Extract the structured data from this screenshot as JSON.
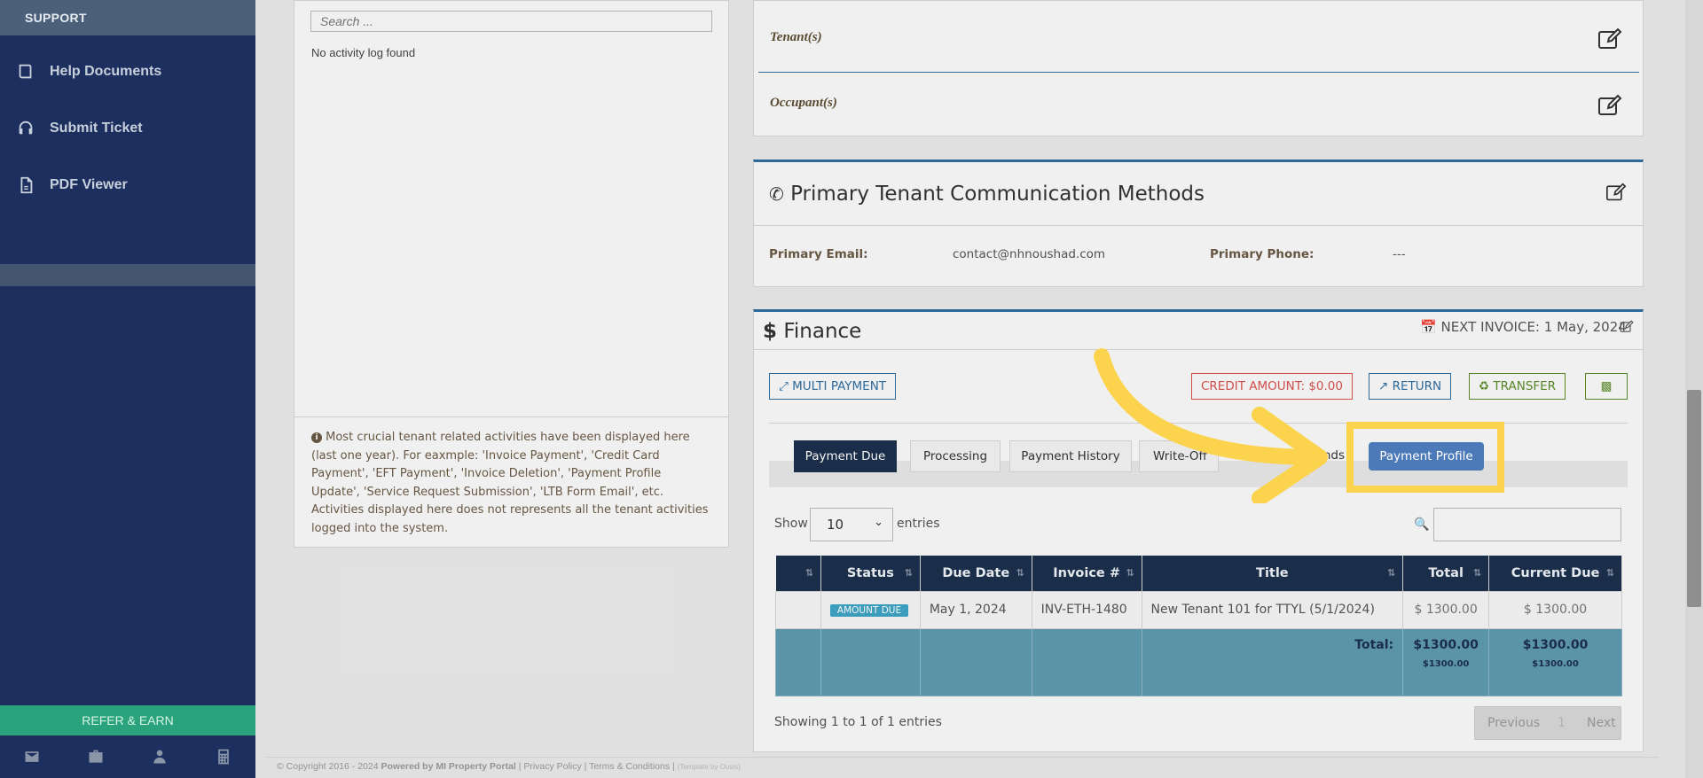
{
  "sidebar": {
    "header": "SUPPORT",
    "items": [
      {
        "label": "Help Documents",
        "icon": "book-icon"
      },
      {
        "label": "Submit Ticket",
        "icon": "headset-icon"
      },
      {
        "label": "PDF Viewer",
        "icon": "pdf-icon"
      }
    ],
    "refer": "REFER & EARN"
  },
  "activity": {
    "search_placeholder": "Search ...",
    "empty": "No activity log found",
    "note": "Most crucial tenant related activities have been displayed here (last one year). For eaxmple: 'Invoice Payment', 'Credit Card Payment', 'EFT Payment', 'Invoice Deletion', 'Payment Profile Update', 'Service Request Submission', 'LTB Form Email', etc. Activities displayed here does not represents all the tenant activities logged into the system."
  },
  "people": {
    "tenants": "Tenant(s)",
    "occupants": "Occupant(s)"
  },
  "comm": {
    "title": "Primary Tenant Communication Methods",
    "email_label": "Primary Email:",
    "email_value": "contact@nhnoushad.com",
    "phone_label": "Primary Phone:",
    "phone_value": "---"
  },
  "finance": {
    "title": "Finance",
    "next_invoice": "NEXT INVOICE: 1 May, 2024",
    "multi_payment": "MULTI PAYMENT",
    "credit": "CREDIT AMOUNT: $0.00",
    "return": "RETURN",
    "transfer": "TRANSFER",
    "tabs": [
      "Payment Due",
      "Processing",
      "Payment History",
      "Write-Off",
      "Refunds",
      "Payment Profile"
    ],
    "show": "Show",
    "entries_value": "10",
    "entries": "entries",
    "columns": [
      "",
      "Status",
      "Due Date",
      "Invoice #",
      "Title",
      "Total",
      "Current Due"
    ],
    "row": {
      "status": "AMOUNT DUE",
      "due_date": "May 1, 2024",
      "invoice": "INV-ETH-1480",
      "title": "New Tenant 101 for TTYL (5/1/2024)",
      "total": "$ 1300.00",
      "current_due": "$ 1300.00"
    },
    "totals": {
      "label": "Total:",
      "total": "$1300.00",
      "total_sub": "$1300.00",
      "current": "$1300.00",
      "current_sub": "$1300.00"
    },
    "showing": "Showing 1 to 1 of 1 entries",
    "prev": "Previous",
    "page": "1",
    "next": "Next"
  },
  "footer": {
    "copyright": "© Copyright 2016 - 2024",
    "powered": "Powered by MI Property Portal",
    "privacy": "Privacy Policy",
    "terms": "Terms & Conditions",
    "template": "(Template by Ousis)"
  },
  "colors": {
    "sidebar": "#1c2f5e",
    "accent": "#4c79b8",
    "highlight": "#fcd34d",
    "credit": "#d9534f",
    "return": "#2f6ea0",
    "transfer": "#5b8c2a"
  }
}
